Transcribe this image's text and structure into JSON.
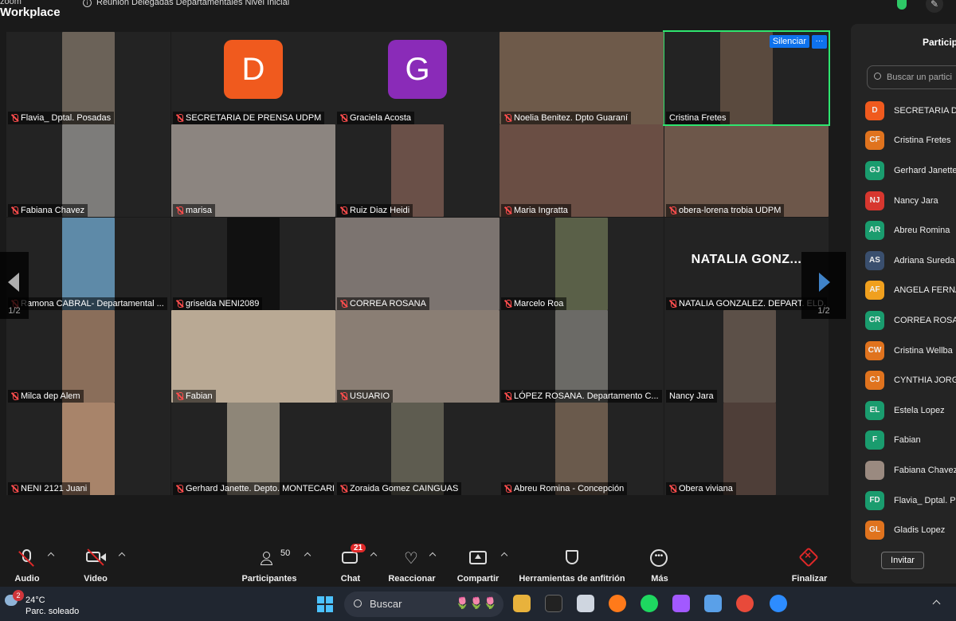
{
  "window": {
    "brand_top": "zoom",
    "brand": "Workplace",
    "meeting_title": "Reunion Delegadas Departamentales Nivel Inicial"
  },
  "tiles": [
    {
      "name": "Flavia_ Dptal. Posadas",
      "muted": true,
      "type": "video",
      "cam": "#6b6258"
    },
    {
      "name": "SECRETARIA DE PRENSA UDPM",
      "muted": true,
      "type": "avatar",
      "letter": "D",
      "color": "#f05a1e"
    },
    {
      "name": "Graciela Acosta",
      "muted": true,
      "type": "avatar",
      "letter": "G",
      "color": "#8a2bb8"
    },
    {
      "name": "Noelia Benitez. Dpto Guaraní",
      "muted": true,
      "type": "video",
      "cam": "#6e5a4a"
    },
    {
      "name": "Cristina Fretes",
      "muted": false,
      "type": "video",
      "cam": "#5a4a3e",
      "active": true
    },
    {
      "name": "Fabiana Chavez",
      "muted": true,
      "type": "video",
      "cam": "#7d7c7a"
    },
    {
      "name": "marisa",
      "muted": true,
      "type": "video",
      "cam": "#8c8580"
    },
    {
      "name": "Ruiz Diaz Heidi",
      "muted": true,
      "type": "video",
      "cam": "#6a5048"
    },
    {
      "name": "Maria Ingratta",
      "muted": true,
      "type": "video",
      "cam": "#6a4e44"
    },
    {
      "name": "obera-lorena trobia UDPM",
      "muted": true,
      "type": "video",
      "cam": "#6d574a"
    },
    {
      "name": "Ramona CABRAL- Departamental ...",
      "muted": true,
      "type": "video",
      "cam": "#5e8aa8"
    },
    {
      "name": "griselda NENI2089",
      "muted": true,
      "type": "video",
      "cam": "#111111"
    },
    {
      "name": "CORREA ROSANA",
      "muted": true,
      "type": "video",
      "cam": "#7c7470"
    },
    {
      "name": "Marcelo Roa",
      "muted": true,
      "type": "video",
      "cam": "#5a6048"
    },
    {
      "name": "NATALIA GONZALEZ. DEPART. ELD...",
      "muted": true,
      "type": "text",
      "bigname": "NATALIA  GONZ..."
    },
    {
      "name": "Milca dep Alem",
      "muted": true,
      "type": "video",
      "cam": "#8a6e5a"
    },
    {
      "name": "Fabian",
      "muted": true,
      "type": "video",
      "cam": "#b9a994"
    },
    {
      "name": "USUARIO",
      "muted": true,
      "type": "video",
      "cam": "#8a7e74"
    },
    {
      "name": "LÓPEZ ROSANA. Departamento C...",
      "muted": true,
      "type": "video",
      "cam": "#6b6a66"
    },
    {
      "name": "Nancy Jara",
      "muted": false,
      "type": "video",
      "cam": "#5c5048"
    },
    {
      "name": "NENI 2121 Juani",
      "muted": true,
      "type": "video",
      "cam": "#a8846a"
    },
    {
      "name": "Gerhard Janette. Depto. MONTECARL...",
      "muted": true,
      "type": "video",
      "cam": "#8e8678"
    },
    {
      "name": "Zoraida Gomez CAINGUAS",
      "muted": true,
      "type": "video",
      "cam": "#5e5c50"
    },
    {
      "name": "Abreu Romina - Concepción",
      "muted": true,
      "type": "video",
      "cam": "#6a5a4c"
    },
    {
      "name": "Obera viviana",
      "muted": true,
      "type": "video",
      "cam": "#4e3e38"
    }
  ],
  "active_tile": {
    "silenciar": "Silenciar",
    "more": "···"
  },
  "pager": {
    "left": "1/2",
    "right": "1/2"
  },
  "participants_panel": {
    "title": "Particip",
    "search_placeholder": "Buscar un partici",
    "invite": "Invitar",
    "items": [
      {
        "initials": "D",
        "name": "SECRETARIA DE",
        "color": "#f05a1e"
      },
      {
        "initials": "CF",
        "name": "Cristina Fretes",
        "color": "#e0731e"
      },
      {
        "initials": "GJ",
        "name": "Gerhard Janette",
        "color": "#1a9c6e"
      },
      {
        "initials": "NJ",
        "name": "Nancy Jara",
        "color": "#d7372f"
      },
      {
        "initials": "AR",
        "name": "Abreu Romina",
        "color": "#1a9c6e"
      },
      {
        "initials": "AS",
        "name": "Adriana Sureda",
        "color": "#3a4f6e"
      },
      {
        "initials": "AF",
        "name": "ANGELA FERNA",
        "color": "#f0a01e"
      },
      {
        "initials": "CR",
        "name": "CORREA ROSAN",
        "color": "#1a9c6e"
      },
      {
        "initials": "CW",
        "name": "Cristina Wellba",
        "color": "#e0731e"
      },
      {
        "initials": "CJ",
        "name": "CYNTHIA JORG",
        "color": "#e0731e"
      },
      {
        "initials": "EL",
        "name": "Estela Lopez",
        "color": "#1a9c6e"
      },
      {
        "initials": "F",
        "name": "Fabian",
        "color": "#1a9c6e"
      },
      {
        "initials": "",
        "name": "Fabiana Chavez",
        "color": "#9a8a80"
      },
      {
        "initials": "FD",
        "name": "Flavia_ Dptal. P",
        "color": "#1a9c6e"
      },
      {
        "initials": "GL",
        "name": "Gladis Lopez",
        "color": "#e0731e"
      }
    ]
  },
  "toolbar": {
    "audio": "Audio",
    "video": "Video",
    "participants": "Participantes",
    "participants_count": "50",
    "chat": "Chat",
    "chat_badge": "21",
    "react": "Reaccionar",
    "share": "Compartir",
    "host_tools": "Herramientas de anfitrión",
    "more": "Más",
    "end": "Finalizar"
  },
  "taskbar": {
    "temp": "24°C",
    "weather": "Parc. soleado",
    "weather_badge": "2",
    "search": "Buscar"
  }
}
